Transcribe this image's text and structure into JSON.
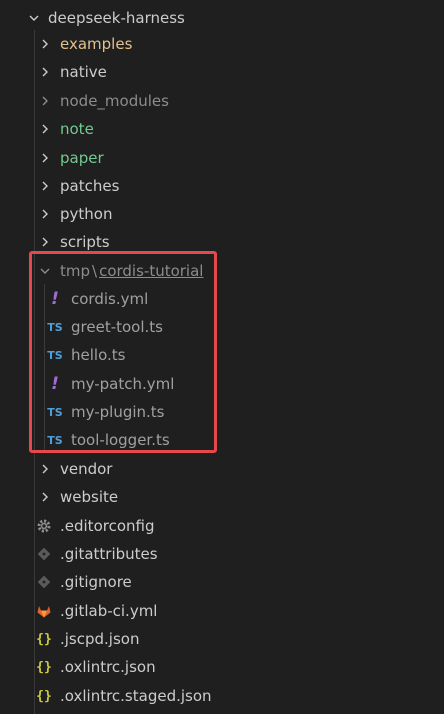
{
  "root": {
    "label": "deepseek-harness",
    "expanded": true
  },
  "folders_top": [
    {
      "label": "examples",
      "color": "#e2c08d"
    },
    {
      "label": "native",
      "color": "#cccccc"
    },
    {
      "label": "node_modules",
      "color": "#8c8c8c"
    },
    {
      "label": "note",
      "color": "#73c991"
    },
    {
      "label": "paper",
      "color": "#73c991"
    },
    {
      "label": "patches",
      "color": "#cccccc"
    },
    {
      "label": "python",
      "color": "#cccccc"
    },
    {
      "label": "scripts",
      "color": "#cccccc"
    }
  ],
  "tmp_folder": {
    "label": "tmp",
    "separator": "\\",
    "sub_label": "cordis-tutorial",
    "expanded": true
  },
  "tmp_files": [
    {
      "label": "cordis.yml",
      "icon": "yaml-icon"
    },
    {
      "label": "greet-tool.ts",
      "icon": "typescript-icon"
    },
    {
      "label": "hello.ts",
      "icon": "typescript-icon"
    },
    {
      "label": "my-patch.yml",
      "icon": "yaml-icon"
    },
    {
      "label": "my-plugin.ts",
      "icon": "typescript-icon"
    },
    {
      "label": "tool-logger.ts",
      "icon": "typescript-icon"
    }
  ],
  "folders_bottom": [
    {
      "label": "vendor"
    },
    {
      "label": "website"
    }
  ],
  "root_files": [
    {
      "label": ".editorconfig",
      "icon": "gear-icon"
    },
    {
      "label": ".gitattributes",
      "icon": "git-icon"
    },
    {
      "label": ".gitignore",
      "icon": "git-icon"
    },
    {
      "label": ".gitlab-ci.yml",
      "icon": "gitlab-icon"
    },
    {
      "label": ".jscpd.json",
      "icon": "json-icon"
    },
    {
      "label": ".oxlintrc.json",
      "icon": "json-icon"
    },
    {
      "label": ".oxlintrc.staged.json",
      "icon": "json-icon"
    }
  ],
  "icons": {
    "ts_glyph": "TS",
    "yml_glyph": "!",
    "json_glyph": "{}"
  },
  "colors": {
    "highlight": "#e5484d",
    "background": "#1f1f1f",
    "dimmed": "#8c8c8c"
  }
}
